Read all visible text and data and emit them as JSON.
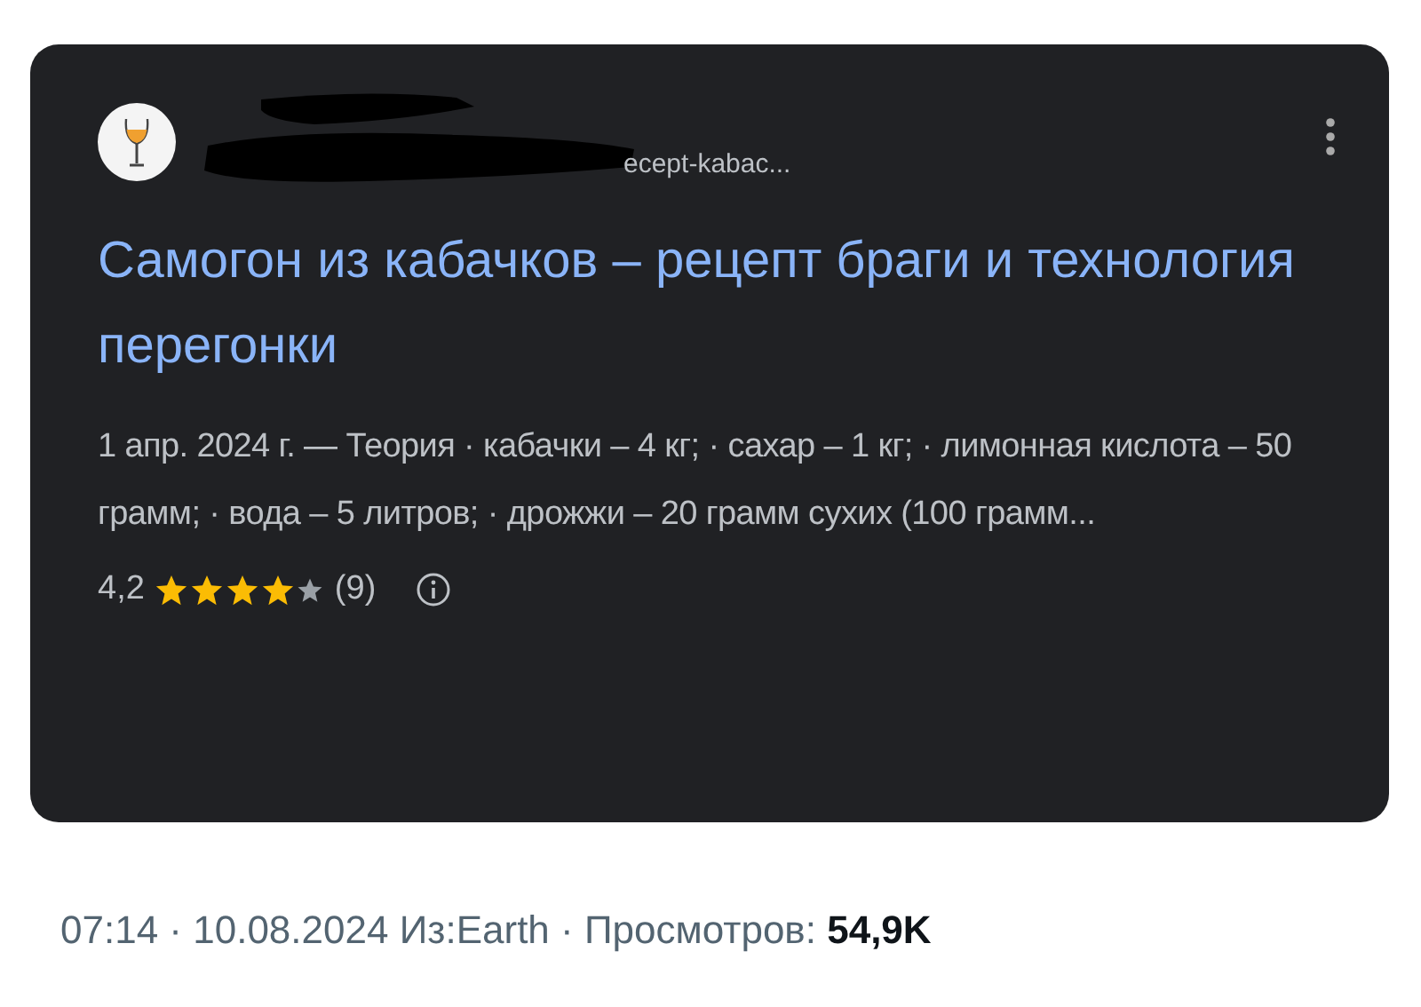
{
  "result": {
    "url": "ecept-kabac...",
    "title": "Самогон из кабачков – рецепт браги и технология перегонки",
    "snippet": "1 апр. 2024 г. — Теория · кабачки – 4 кг; · сахар – 1 кг; · лимонная кислота – 50 грамм; · вода – 5 литров; · дрожжи – 20 грамм сухих (100 грамм...",
    "rating": "4,2",
    "stars": 4,
    "reviews": "(9)"
  },
  "footer": "07:14 · 10.08.2024 Из:Earth · Просмотров: **54,9K**"
}
